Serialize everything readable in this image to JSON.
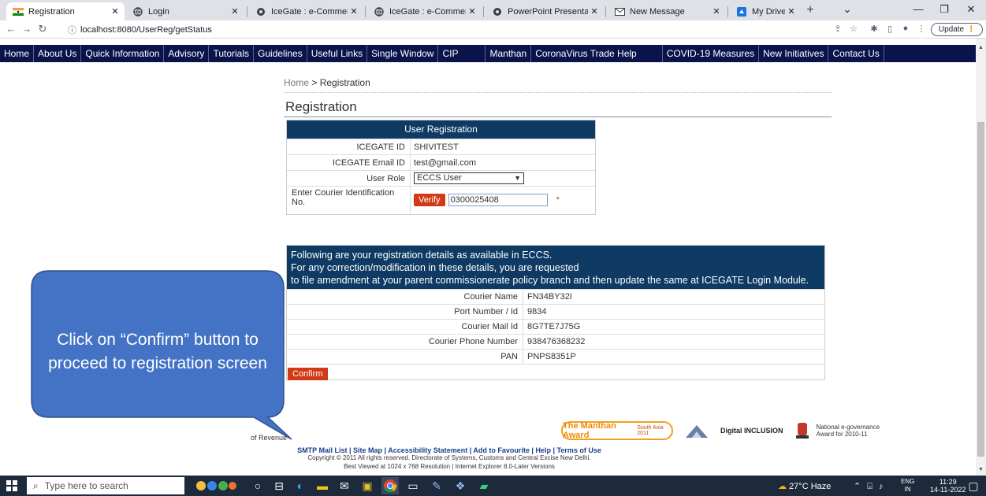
{
  "browser": {
    "tabs": [
      {
        "label": "Registration",
        "icon": "india-flag-icon",
        "active": true
      },
      {
        "label": "Login",
        "icon": "globe-icon"
      },
      {
        "label": "IceGate : e-Commerce",
        "icon": "icegate-icon"
      },
      {
        "label": "IceGate : e-Commerce",
        "icon": "globe-icon"
      },
      {
        "label": "PowerPoint Presentatio",
        "icon": "icegate-icon"
      },
      {
        "label": "New Message",
        "icon": "mail-icon"
      },
      {
        "label": "My Drive",
        "icon": "drive-icon"
      }
    ],
    "new_tab": "+",
    "url_info": "ⓘ",
    "url_host": "localhost:8080/UserReg/getStatus",
    "update_label": "Update"
  },
  "nav": {
    "items": [
      "Home",
      "About Us",
      "Quick Information",
      "Advisory",
      "Tutorials",
      "Guidelines",
      "Useful Links",
      "Single Window",
      "CIP",
      "Manthan",
      "CoronaVirus Trade Help",
      "COVID-19 Measures",
      "New Initiatives",
      "Contact Us"
    ],
    "bg_color": "#0a144b"
  },
  "breadcrumb": {
    "home": "Home",
    "sep": ">",
    "current": "Registration"
  },
  "page_title": "Registration",
  "form": {
    "header": "User Registration",
    "icegate_id_label": "ICEGATE ID",
    "icegate_id_value": "SHIVITEST",
    "email_label": "ICEGATE Email ID",
    "email_value": "test@gmail.com",
    "role_label": "User Role",
    "role_value": "ECCS User",
    "courier_label": "Enter Courier Identification No.",
    "verify_label": "Verify",
    "courier_value": "0300025408",
    "required_mark": "*"
  },
  "details": {
    "header_lines": [
      "Following are your registration details as available in ECCS.",
      "For any correction/modification in these details, you are requested",
      "to file amendment at your parent commissionerate policy branch and then update the same at ICEGATE Login Module."
    ],
    "rows": [
      {
        "label": "Courier Name",
        "value": "FN34BY32I"
      },
      {
        "label": "Port Number / Id",
        "value": "9834"
      },
      {
        "label": "Courier Mail Id",
        "value": "8G7TE7J75G"
      },
      {
        "label": "Courier Phone Number",
        "value": "938476368232"
      },
      {
        "label": "PAN",
        "value": "PNPS8351P"
      }
    ],
    "confirm_label": "Confirm"
  },
  "callout": {
    "text": "Click on “Confirm” button to proceed to registration screen",
    "fill": "#4472c4",
    "stroke": "#2f528f"
  },
  "footer": {
    "revenue": "of Revenue",
    "manthan": "The Manthan Award",
    "manthan_sub": "South Asia 2011",
    "digital_inclusion": "Digital INCLUSION",
    "egov": "National e-governance Award for 2010-11",
    "links": "SMTP Mail List | Site Map | Accessibility Statement | Add to Favourite | Help | Terms of Use",
    "copyright": "Copyright © 2011 All rights reserved. Directorate of Systems, Customs and Central Excise New Delhi.",
    "best_viewed": "Best Viewed at 1024 x 768 Resolution | Internet Explorer 8.0-Later Versions"
  },
  "taskbar": {
    "search_placeholder": "Type here to search",
    "weather": "27°C Haze",
    "lang_top": "ENG",
    "lang_bottom": "IN",
    "time": "11:29",
    "date": "14-11-2022"
  }
}
